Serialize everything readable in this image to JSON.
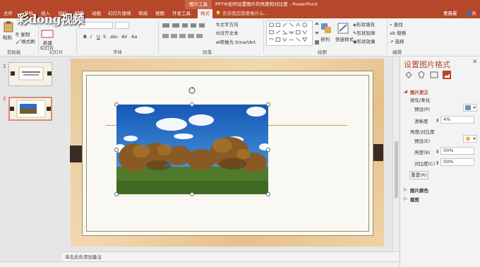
{
  "titlebar": {
    "context_tab": "图片工具",
    "doc_title": "PPT中如何设置图片的亮度和对比度 - PowerPoint"
  },
  "tabs": [
    {
      "label": "文件"
    },
    {
      "label": "开始"
    },
    {
      "label": "插入"
    },
    {
      "label": "设计"
    },
    {
      "label": "切换"
    },
    {
      "label": "动画"
    },
    {
      "label": "幻灯片放映"
    },
    {
      "label": "审阅"
    },
    {
      "label": "视图"
    },
    {
      "label": "开发工具"
    },
    {
      "label": "格式"
    }
  ],
  "tell_me": "告诉我您想要做什么...",
  "user_name": "曹晨曼",
  "share": "共享",
  "watermark": "彩dong视频",
  "ribbon": {
    "clipboard": {
      "paste": "粘贴",
      "copy": "复制",
      "format_painter": "格式刷",
      "label": "剪贴板"
    },
    "slides": {
      "new": "新建",
      "new2": "幻灯片",
      "label": "幻灯片"
    },
    "font": {
      "label": "字体",
      "bold": "B",
      "italic": "I",
      "underline": "U",
      "strike": "S",
      "shadow": "abc",
      "spacing": "AV",
      "case": "Aa"
    },
    "paragraph": {
      "text_direction": "文字方向",
      "align_text": "对齐文本",
      "smartart": "转换为 SmartArt",
      "label": "段落"
    },
    "drawing": {
      "arrange": "排列",
      "quick_styles": "快速样式",
      "fill": "形状填充",
      "outline": "形状轮廓",
      "effects": "形状效果",
      "label": "绘图"
    },
    "editing": {
      "find": "查找",
      "replace": "替换",
      "select": "选择",
      "label": "编辑"
    }
  },
  "slides_panel": [
    {
      "number": "1"
    },
    {
      "number": "2"
    }
  ],
  "notes_placeholder": "单击此处添加备注",
  "format_pane": {
    "title": "设置图片格式",
    "close": "✕",
    "section_corrections": "图片更正",
    "sharpen_soften": "锐化/柔化",
    "preset_label_1": "预设(P)",
    "sharpness_label": "清晰度",
    "sharpness_value": "4%",
    "brightness_contrast": "亮度/对比度",
    "preset_label_2": "预设(E)",
    "brightness_label": "亮度(B)",
    "brightness_value": "00%",
    "contrast_label": "对比度(C)",
    "contrast_value": "00%",
    "reset_button": "重置(R)",
    "picture_color": "图片颜色",
    "crop": "裁剪"
  },
  "colors": {
    "accent": "#b7472a",
    "slide_frame": "#3a2c24"
  }
}
